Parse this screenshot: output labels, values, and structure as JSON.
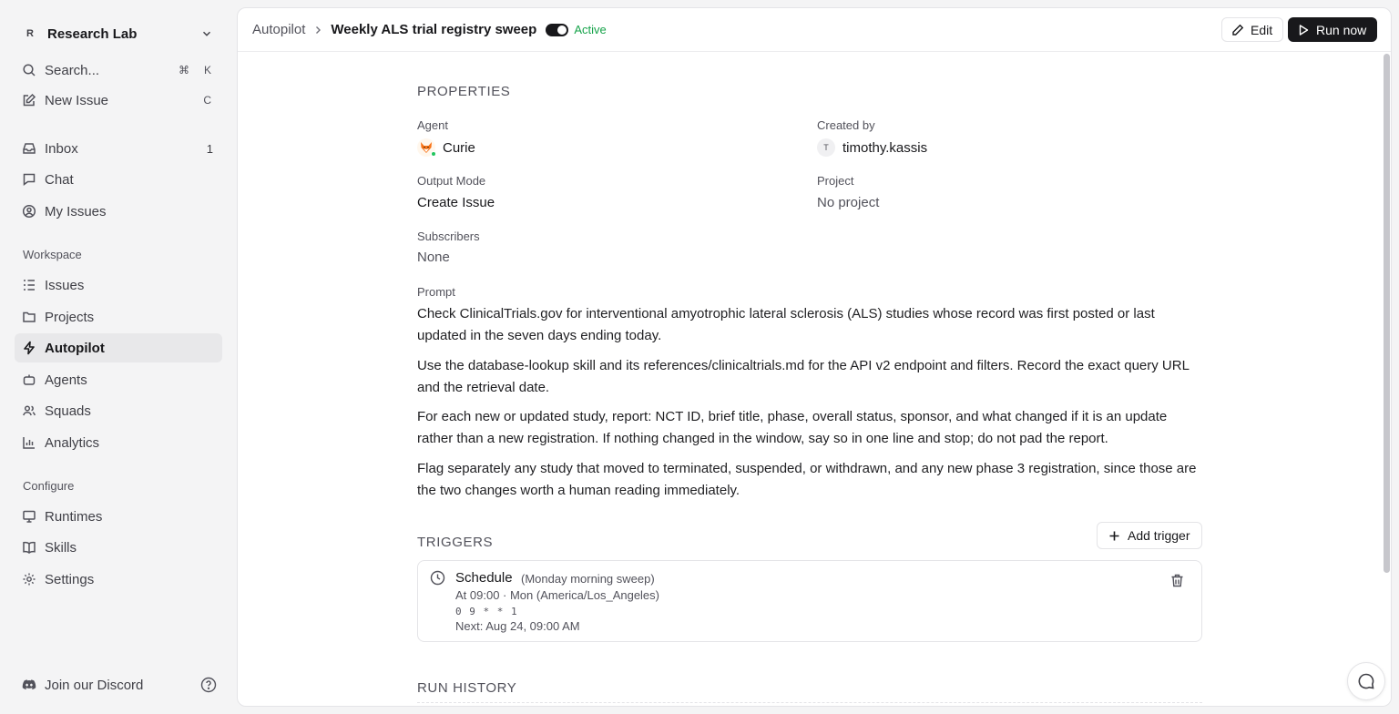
{
  "sidebar": {
    "workspace": {
      "initial": "R",
      "name": "Research Lab"
    },
    "search": {
      "label": "Search...",
      "kbd1": "⌘",
      "kbd2": "K"
    },
    "new_issue": {
      "label": "New Issue",
      "kbd": "C"
    },
    "inbox": {
      "label": "Inbox",
      "badge": "1"
    },
    "chat": {
      "label": "Chat"
    },
    "my_issues": {
      "label": "My Issues"
    },
    "workspace_section": "Workspace",
    "issues": {
      "label": "Issues"
    },
    "projects": {
      "label": "Projects"
    },
    "autopilot": {
      "label": "Autopilot"
    },
    "agents": {
      "label": "Agents"
    },
    "squads": {
      "label": "Squads"
    },
    "analytics": {
      "label": "Analytics"
    },
    "configure_section": "Configure",
    "runtimes": {
      "label": "Runtimes"
    },
    "skills": {
      "label": "Skills"
    },
    "settings": {
      "label": "Settings"
    },
    "discord": {
      "label": "Join our Discord"
    }
  },
  "header": {
    "breadcrumb_root": "Autopilot",
    "title": "Weekly ALS trial registry sweep",
    "status": "Active",
    "edit_label": "Edit",
    "run_label": "Run now"
  },
  "properties": {
    "heading": "PROPERTIES",
    "agent_label": "Agent",
    "agent_value": "Curie",
    "created_by_label": "Created by",
    "created_by_initial": "T",
    "created_by_value": "timothy.kassis",
    "output_mode_label": "Output Mode",
    "output_mode_value": "Create Issue",
    "project_label": "Project",
    "project_value": "No project",
    "subscribers_label": "Subscribers",
    "subscribers_value": "None",
    "prompt_label": "Prompt",
    "prompt_paragraphs": [
      "Check ClinicalTrials.gov for interventional amyotrophic lateral sclerosis (ALS) studies whose record was first posted or last updated in the seven days ending today.",
      "Use the database-lookup skill and its references/clinicaltrials.md for the API v2 endpoint and filters. Record the exact query URL and the retrieval date.",
      "For each new or updated study, report: NCT ID, brief title, phase, overall status, sponsor, and what changed if it is an update rather than a new registration. If nothing changed in the window, say so in one line and stop; do not pad the report.",
      "Flag separately any study that moved to terminated, suspended, or withdrawn, and any new phase 3 registration, since those are the two changes worth a human reading immediately."
    ]
  },
  "triggers": {
    "heading": "TRIGGERS",
    "add_label": "Add trigger",
    "items": [
      {
        "type": "Schedule",
        "name": "(Monday morning sweep)",
        "when": "At 09:00 · Mon (America/Los_Angeles)",
        "cron": "0 9 * * 1",
        "next": "Next: Aug 24, 09:00 AM"
      }
    ]
  },
  "run_history": {
    "heading": "RUN HISTORY"
  },
  "colors": {
    "accent": "#18181b",
    "active_green": "#16a34a",
    "sidebar_bg": "#f4f4f5"
  }
}
